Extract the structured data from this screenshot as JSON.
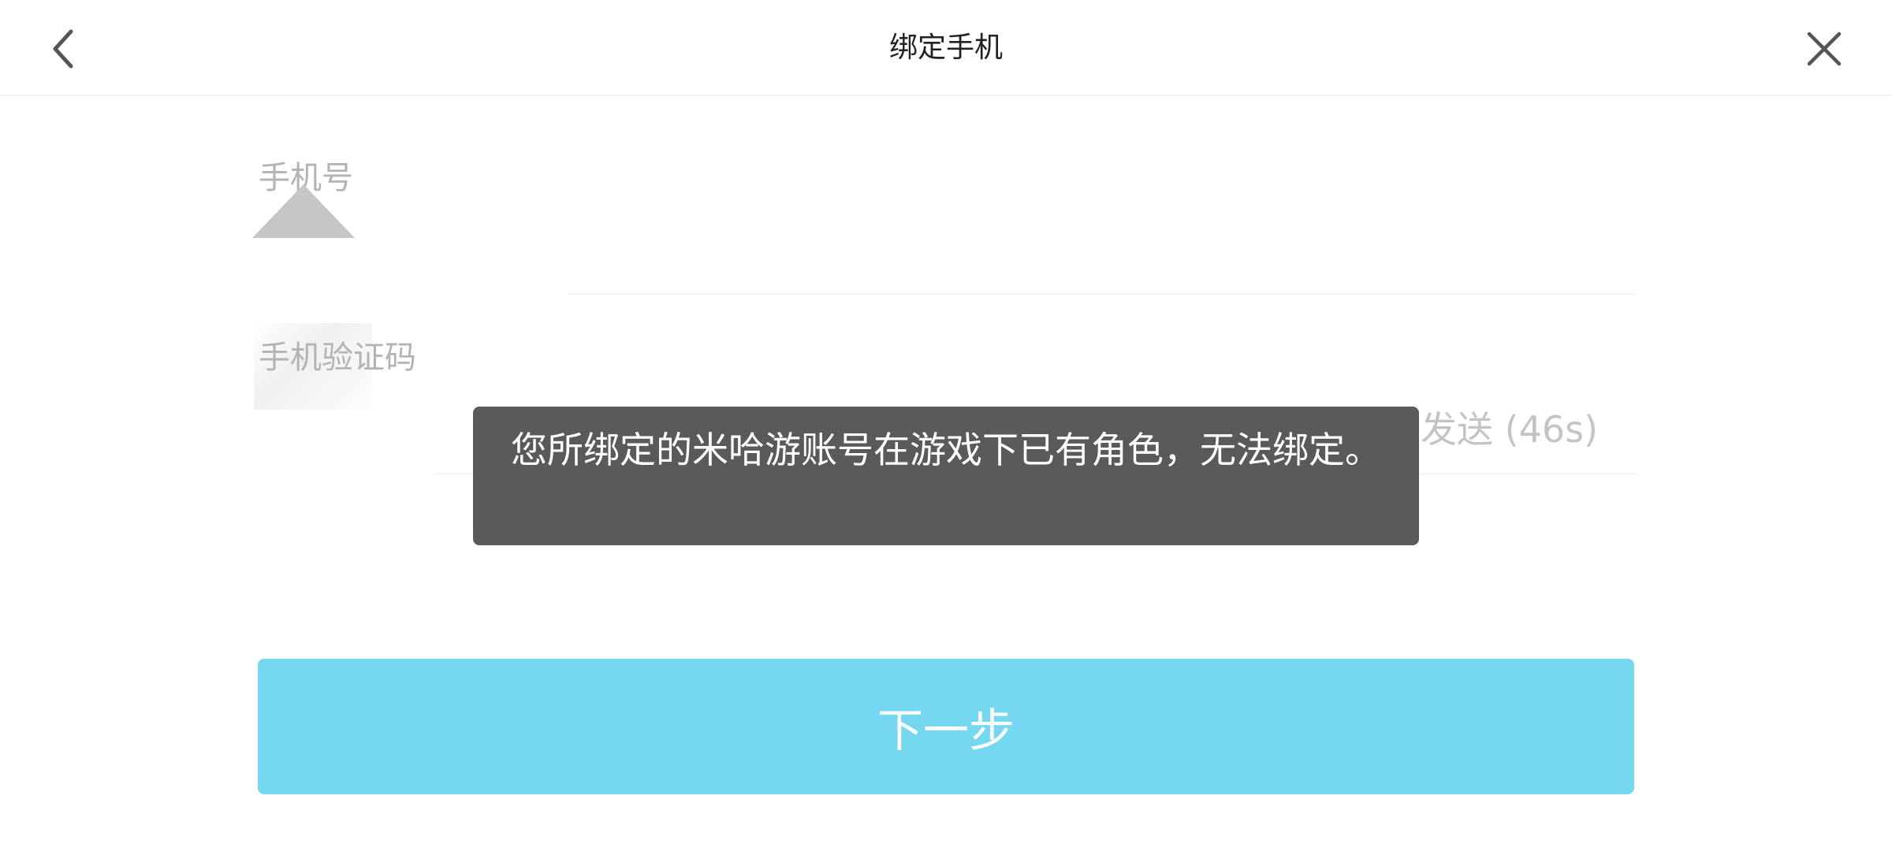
{
  "header": {
    "title": "绑定手机",
    "back_icon": "chevron-left-icon",
    "close_icon": "close-icon"
  },
  "form": {
    "phone_label": "手机号",
    "code_label": "手机验证码",
    "resend_label": "已发送 (46s)"
  },
  "next_button": {
    "label": "下一步",
    "color": "#76d8f0"
  },
  "toast": {
    "message": "您所绑定的米哈游账号在游戏下已有角色，无法绑定。"
  },
  "colors": {
    "header_text": "#222222",
    "label_text": "#b3b3b3",
    "toast_bg": "#5a5a5a"
  }
}
